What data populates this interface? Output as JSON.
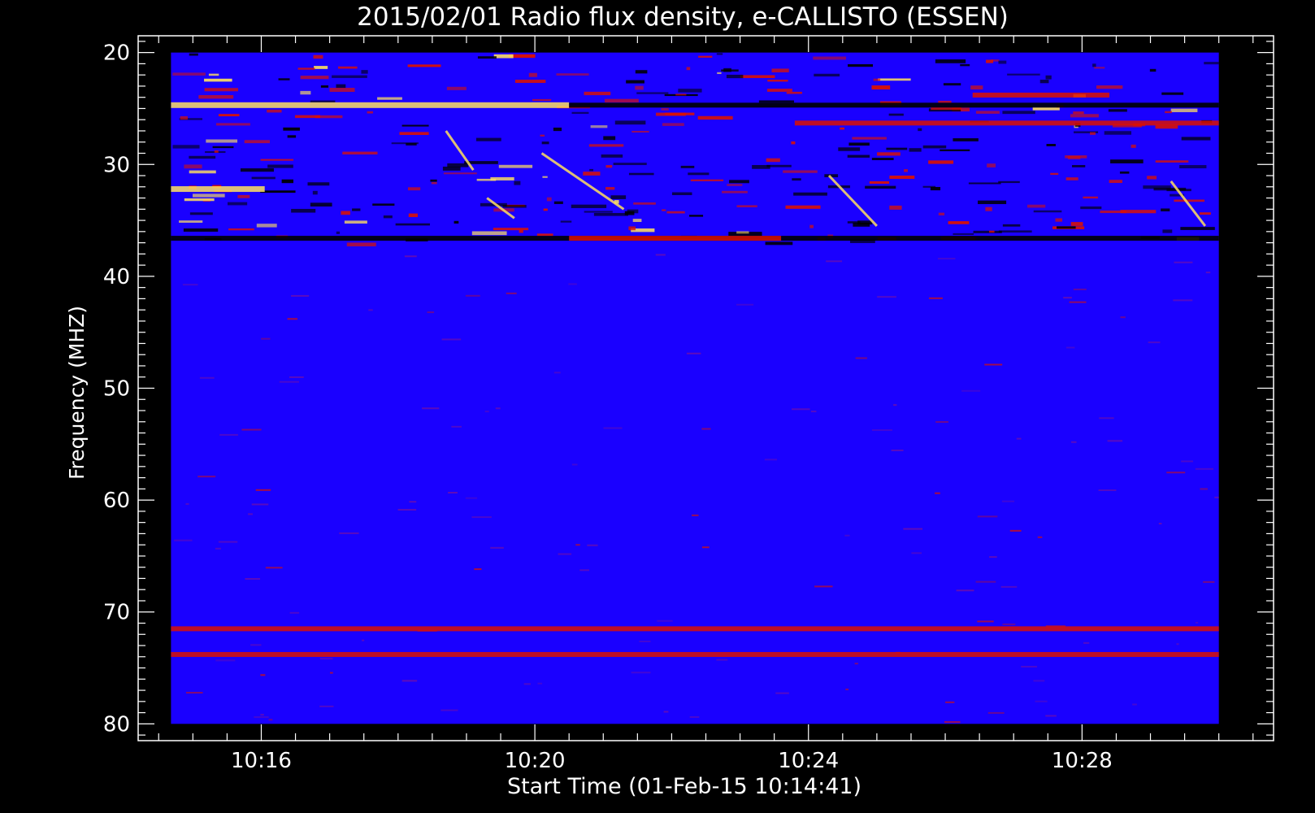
{
  "chart_data": {
    "type": "heatmap",
    "title": "2015/02/01  Radio flux density, e-CALLISTO (ESSEN)",
    "xlabel": "Start Time (01-Feb-15 10:14:41)",
    "ylabel": "Frequency (MHZ)",
    "x_range_minutes": [
      14.2,
      30.8
    ],
    "x_ticks": [
      {
        "label": "10:16",
        "minute": 16
      },
      {
        "label": "10:20",
        "minute": 20
      },
      {
        "label": "10:24",
        "minute": 24
      },
      {
        "label": "10:28",
        "minute": 28
      }
    ],
    "y_range_mhz": [
      18.5,
      81.5
    ],
    "y_axis_inverted": true,
    "y_ticks": [
      20,
      30,
      40,
      50,
      60,
      70,
      80
    ],
    "data_extent": {
      "time_start_minute": 14.68,
      "time_end_minute": 30.0,
      "freq_min_mhz": 20,
      "freq_max_mhz": 80
    },
    "colormap": {
      "background": "#1a00ff",
      "low": "#000000",
      "mid": "#dd1100",
      "high": "#ffe060"
    },
    "features": [
      {
        "kind": "band",
        "freq_mhz": 24.7,
        "t0": 14.68,
        "t1": 20.5,
        "level": "high"
      },
      {
        "kind": "band",
        "freq_mhz": 24.7,
        "t0": 20.5,
        "t1": 30.0,
        "level": "low"
      },
      {
        "kind": "band",
        "freq_mhz": 32.2,
        "t0": 14.68,
        "t1": 16.05,
        "level": "high"
      },
      {
        "kind": "band",
        "freq_mhz": 26.3,
        "t0": 23.8,
        "t1": 30.0,
        "level": "mid"
      },
      {
        "kind": "band",
        "freq_mhz": 36.6,
        "t0": 14.68,
        "t1": 30.0,
        "level": "low"
      },
      {
        "kind": "band",
        "freq_mhz": 36.6,
        "t0": 20.5,
        "t1": 23.6,
        "level": "mid"
      },
      {
        "kind": "band",
        "freq_mhz": 71.5,
        "t0": 14.68,
        "t1": 30.0,
        "level": "mid"
      },
      {
        "kind": "band",
        "freq_mhz": 73.8,
        "t0": 14.68,
        "t1": 30.0,
        "level": "mid"
      },
      {
        "kind": "band",
        "freq_mhz": 23.8,
        "t0": 26.4,
        "t1": 28.4,
        "level": "mid"
      },
      {
        "kind": "burst",
        "t0": 20.1,
        "f0": 29.0,
        "t1": 21.3,
        "f1": 34.0
      },
      {
        "kind": "burst",
        "t0": 24.3,
        "f0": 31.0,
        "t1": 25.0,
        "f1": 35.5
      },
      {
        "kind": "burst",
        "t0": 29.3,
        "f0": 31.5,
        "t1": 29.8,
        "f1": 35.5
      },
      {
        "kind": "burst",
        "t0": 19.3,
        "f0": 33.0,
        "t1": 19.7,
        "f1": 34.8
      },
      {
        "kind": "burst",
        "t0": 18.7,
        "f0": 27.0,
        "t1": 19.1,
        "f1": 30.5
      }
    ]
  }
}
